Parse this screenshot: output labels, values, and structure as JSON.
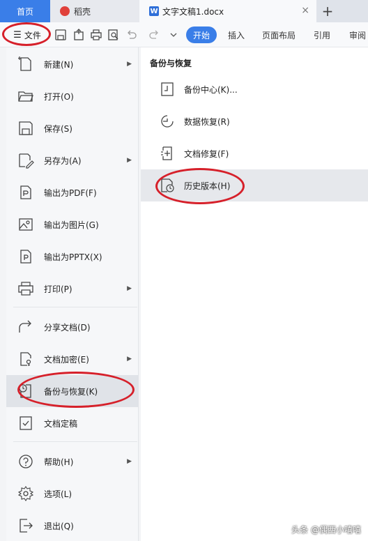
{
  "tabs": {
    "home": "首页",
    "daoke": "稻壳",
    "document": "文字文稿1.docx",
    "close": "×",
    "add": "+"
  },
  "toolbar": {
    "file_label": "文件",
    "ribbon_tabs": [
      "开始",
      "插入",
      "页面布局",
      "引用",
      "审阅"
    ],
    "active_tab": "开始"
  },
  "menu": {
    "items": [
      {
        "label": "新建(N)",
        "icon": "new-file-icon",
        "submenu": true
      },
      {
        "label": "打开(O)",
        "icon": "folder-open-icon",
        "submenu": false
      },
      {
        "label": "保存(S)",
        "icon": "save-icon",
        "submenu": false
      },
      {
        "label": "另存为(A)",
        "icon": "save-as-icon",
        "submenu": true
      },
      {
        "label": "输出为PDF(F)",
        "icon": "export-pdf-icon",
        "submenu": false
      },
      {
        "label": "输出为图片(G)",
        "icon": "export-image-icon",
        "submenu": false
      },
      {
        "label": "输出为PPTX(X)",
        "icon": "export-pptx-icon",
        "submenu": false
      },
      {
        "label": "打印(P)",
        "icon": "print-icon",
        "submenu": true
      },
      {
        "label": "分享文档(D)",
        "icon": "share-icon",
        "submenu": false
      },
      {
        "label": "文档加密(E)",
        "icon": "encrypt-icon",
        "submenu": true
      },
      {
        "label": "备份与恢复(K)",
        "icon": "backup-restore-icon",
        "submenu": false,
        "selected": true
      },
      {
        "label": "文档定稿",
        "icon": "finalize-icon",
        "submenu": false
      },
      {
        "label": "帮助(H)",
        "icon": "help-icon",
        "submenu": true
      },
      {
        "label": "选项(L)",
        "icon": "options-gear-icon",
        "submenu": false
      },
      {
        "label": "退出(Q)",
        "icon": "exit-icon",
        "submenu": false
      }
    ]
  },
  "panel": {
    "title": "备份与恢复",
    "items": [
      {
        "label": "备份中心(K)...",
        "icon": "backup-center-icon"
      },
      {
        "label": "数据恢复(R)",
        "icon": "data-recovery-icon"
      },
      {
        "label": "文档修复(F)",
        "icon": "document-repair-icon"
      },
      {
        "label": "历史版本(H)",
        "icon": "history-version-icon",
        "selected": true
      }
    ]
  },
  "watermark": "头条 @偶西小嘻嘻",
  "colors": {
    "accent": "#3a7ee8",
    "annotation": "#d6202a"
  }
}
